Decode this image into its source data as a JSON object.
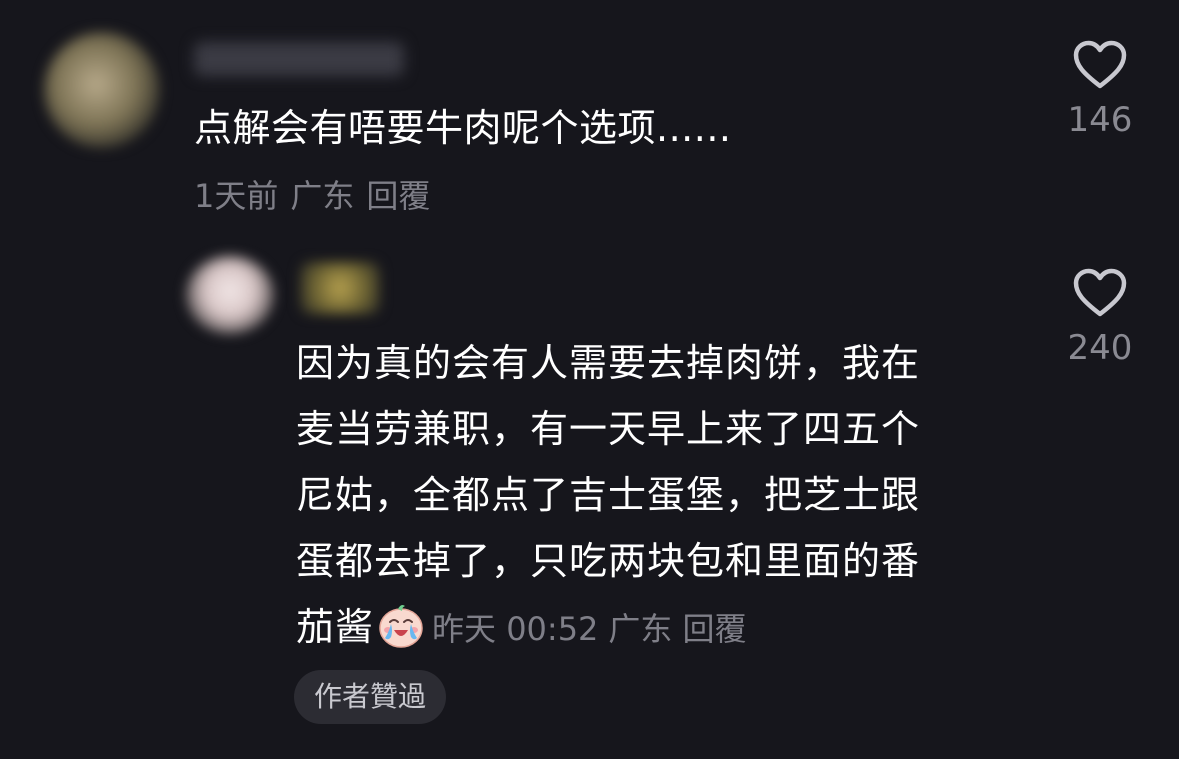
{
  "comments": [
    {
      "text": "点解会有唔要牛肉呢个选项......",
      "time": "1天前",
      "location": "广东",
      "reply_label": "回覆",
      "likes": "146"
    }
  ],
  "reply": {
    "lines": [
      "因为真的会有人需要去掉肉饼，我在",
      "麦当劳兼职，有一天早上来了四五个",
      "尼姑，全都点了吉士蛋堡，把芝士跟",
      "蛋都去掉了，只吃两块包和里面的番",
      "茄酱"
    ],
    "emoji": "crying-laughing-face",
    "time": "昨天 00:52",
    "location": "广东",
    "reply_label": "回覆",
    "likes": "240",
    "author_liked_label": "作者贊過"
  },
  "icons": {
    "like": "heart-outline-icon"
  },
  "colors": {
    "background": "#16161c",
    "text_primary": "#ffffff",
    "text_secondary": "#7f7f88",
    "badge_background": "#2c2c33"
  }
}
